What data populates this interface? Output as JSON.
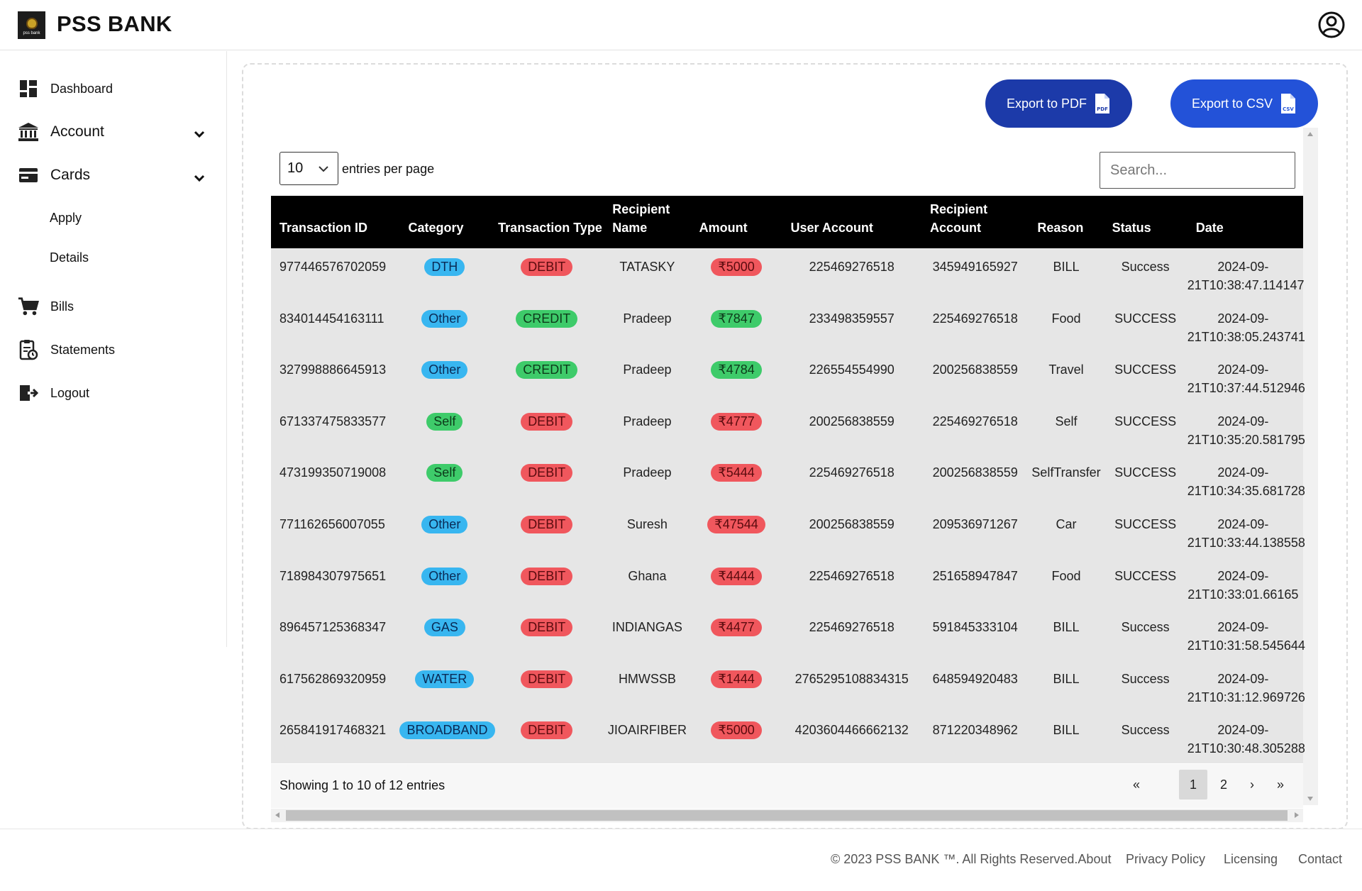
{
  "header": {
    "brand": "PSS BANK",
    "logo_text": "pss bank"
  },
  "sidebar": {
    "items": [
      {
        "label": "Dashboard",
        "icon": "dashboard-icon"
      },
      {
        "label": "Account",
        "icon": "bank-icon",
        "expandable": true
      },
      {
        "label": "Cards",
        "icon": "card-icon",
        "expandable": true
      },
      {
        "label": "Apply"
      },
      {
        "label": "Details"
      },
      {
        "label": "Bills",
        "icon": "cart-icon"
      },
      {
        "label": "Statements",
        "icon": "statement-icon"
      },
      {
        "label": "Logout",
        "icon": "logout-icon"
      }
    ]
  },
  "toolbar": {
    "export_pdf": "Export to PDF",
    "export_csv": "Export to CSV",
    "pdf_badge": "PDF",
    "csv_badge": "CSV"
  },
  "controls": {
    "entries_value": "10",
    "entries_label": "entries per page",
    "search_placeholder": "Search..."
  },
  "table": {
    "columns": [
      "Transaction ID",
      "Category",
      "Transaction Type",
      "Recipient Name",
      "Amount",
      "User Account",
      "Recipient Account",
      "Reason",
      "Status",
      "Date"
    ],
    "rows": [
      {
        "id": "977446576702059",
        "category": "DTH",
        "cat_color": "blue",
        "type": "DEBIT",
        "recipient": "TATASKY",
        "amount": "₹5000",
        "user_account": "225469276518",
        "recipient_account": "345949165927",
        "reason": "BILL",
        "status": "Success",
        "date1": "2024-09-",
        "date2": "21T10:38:47.114147"
      },
      {
        "id": "834014454163111",
        "category": "Other",
        "cat_color": "blue",
        "type": "CREDIT",
        "recipient": "Pradeep",
        "amount": "₹7847",
        "user_account": "233498359557",
        "recipient_account": "225469276518",
        "reason": "Food",
        "status": "SUCCESS",
        "date1": "2024-09-",
        "date2": "21T10:38:05.243741"
      },
      {
        "id": "327998886645913",
        "category": "Other",
        "cat_color": "blue",
        "type": "CREDIT",
        "recipient": "Pradeep",
        "amount": "₹4784",
        "user_account": "226554554990",
        "recipient_account": "200256838559",
        "reason": "Travel",
        "status": "SUCCESS",
        "date1": "2024-09-",
        "date2": "21T10:37:44.512946"
      },
      {
        "id": "671337475833577",
        "category": "Self",
        "cat_color": "green",
        "type": "DEBIT",
        "recipient": "Pradeep",
        "amount": "₹4777",
        "user_account": "200256838559",
        "recipient_account": "225469276518",
        "reason": "Self",
        "status": "SUCCESS",
        "date1": "2024-09-",
        "date2": "21T10:35:20.581795"
      },
      {
        "id": "473199350719008",
        "category": "Self",
        "cat_color": "green",
        "type": "DEBIT",
        "recipient": "Pradeep",
        "amount": "₹5444",
        "user_account": "225469276518",
        "recipient_account": "200256838559",
        "reason": "SelfTransfer",
        "status": "SUCCESS",
        "date1": "2024-09-",
        "date2": "21T10:34:35.681728"
      },
      {
        "id": "771162656007055",
        "category": "Other",
        "cat_color": "blue",
        "type": "DEBIT",
        "recipient": "Suresh",
        "amount": "₹47544",
        "user_account": "200256838559",
        "recipient_account": "209536971267",
        "reason": "Car",
        "status": "SUCCESS",
        "date1": "2024-09-",
        "date2": "21T10:33:44.138558"
      },
      {
        "id": "718984307975651",
        "category": "Other",
        "cat_color": "blue",
        "type": "DEBIT",
        "recipient": "Ghana",
        "amount": "₹4444",
        "user_account": "225469276518",
        "recipient_account": "251658947847",
        "reason": "Food",
        "status": "SUCCESS",
        "date1": "2024-09-",
        "date2": "21T10:33:01.66165"
      },
      {
        "id": "896457125368347",
        "category": "GAS",
        "cat_color": "blue",
        "type": "DEBIT",
        "recipient": "INDIANGAS",
        "amount": "₹4477",
        "user_account": "225469276518",
        "recipient_account": "591845333104",
        "reason": "BILL",
        "status": "Success",
        "date1": "2024-09-",
        "date2": "21T10:31:58.545644"
      },
      {
        "id": "617562869320959",
        "category": "WATER",
        "cat_color": "blue",
        "type": "DEBIT",
        "recipient": "HMWSSB",
        "amount": "₹1444",
        "user_account": "2765295108834315",
        "recipient_account": "648594920483",
        "reason": "BILL",
        "status": "Success",
        "date1": "2024-09-",
        "date2": "21T10:31:12.969726"
      },
      {
        "id": "265841917468321",
        "category": "BROADBAND",
        "cat_color": "blue",
        "type": "DEBIT",
        "recipient": "JIOAIRFIBER",
        "amount": "₹5000",
        "user_account": "4203604466662132",
        "recipient_account": "871220348962",
        "reason": "BILL",
        "status": "Success",
        "date1": "2024-09-",
        "date2": "21T10:30:48.305288"
      }
    ]
  },
  "pagination": {
    "summary": "Showing 1 to 10 of 12 entries",
    "first": "«",
    "page1": "1",
    "page2": "2",
    "next": "›",
    "last": "»",
    "current": 1
  },
  "footer": {
    "copyright": "© 2023 PSS BANK ™. All Rights Reserved.",
    "about": "About",
    "privacy": "Privacy Policy",
    "licensing": "Licensing",
    "contact": "Contact"
  },
  "colors": {
    "pdf_button": "#1c3aa9",
    "csv_button": "#2352d8",
    "pill_blue": "#38b6f0",
    "pill_green": "#3ecb6a",
    "pill_red": "#f0575d",
    "table_header": "#000000"
  }
}
